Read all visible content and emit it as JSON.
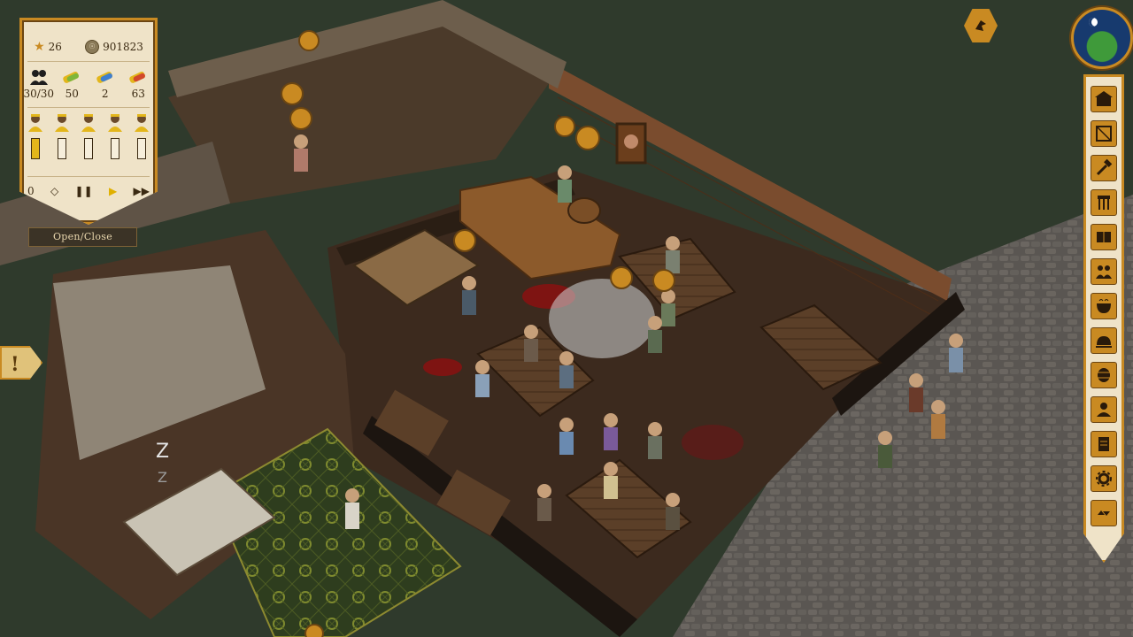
{
  "hud": {
    "stars": "26",
    "gold": "901823",
    "resources": [
      {
        "icon": "staff-icon",
        "value": "30/30"
      },
      {
        "icon": "food-scroll-icon",
        "value": "50"
      },
      {
        "icon": "drink-scroll-icon",
        "value": "2"
      },
      {
        "icon": "supply-scroll-icon",
        "value": "63"
      }
    ],
    "workers": [
      {
        "icon": "worker-cook-icon",
        "fill": 1.0
      },
      {
        "icon": "worker-brewer-icon",
        "fill": 0.0
      },
      {
        "icon": "worker-waiter-icon",
        "fill": 0.0
      },
      {
        "icon": "worker-cleaner-icon",
        "fill": 0.0
      },
      {
        "icon": "worker-guard-icon",
        "fill": 0.0
      }
    ],
    "speed_value": "0",
    "open_close_label": "Open/Close",
    "alert_symbol": "!"
  },
  "toolbar": {
    "tools": [
      "build-tavern-icon",
      "build-room-icon",
      "hammer-icon",
      "kitchen-tools-icon",
      "recipe-book-icon",
      "staff-group-icon",
      "cauldron-icon",
      "service-bell-icon",
      "barrel-icon",
      "customers-icon",
      "ledger-icon",
      "settings-icon",
      "collapse-arrows-icon"
    ]
  },
  "world": {
    "sleep_z1": "Z",
    "sleep_z2": "Z"
  },
  "colors": {
    "accent": "#c98a22",
    "parchment": "#efe3c8",
    "dark_wood": "#3b2a12",
    "grass": "#2f3a2c",
    "cobble": "#5f5a55"
  }
}
